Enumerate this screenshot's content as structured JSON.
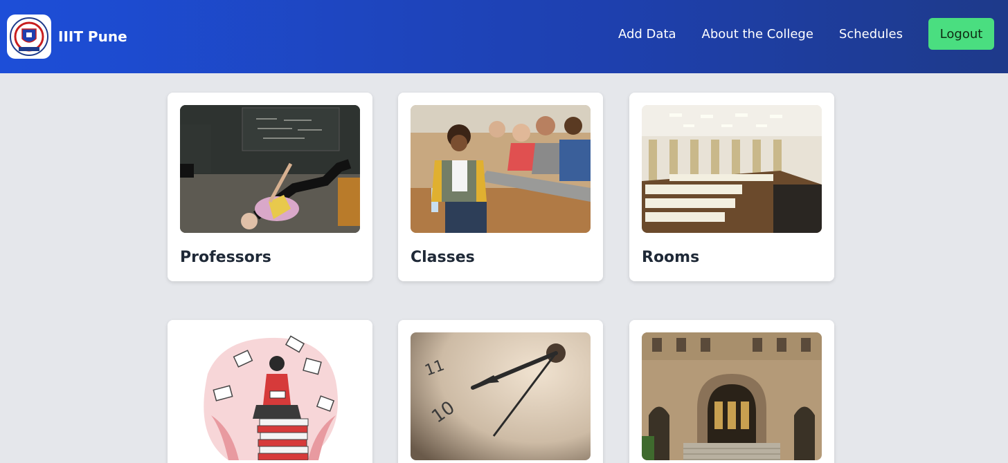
{
  "navbar": {
    "brand": "IIIT Pune",
    "links": [
      "Add Data",
      "About the College",
      "Schedules"
    ],
    "logout_label": "Logout"
  },
  "cards": [
    {
      "title": "Professors",
      "image": "professor-at-chalkboard-image"
    },
    {
      "title": "Classes",
      "image": "students-in-lecture-hall-image"
    },
    {
      "title": "Rooms",
      "image": "auditorium-room-image"
    },
    {
      "title": "",
      "image": "girl-reading-on-books-illustration"
    },
    {
      "title": "",
      "image": "clock-face-closeup-image"
    },
    {
      "title": "",
      "image": "college-building-entrance-image"
    }
  ],
  "colors": {
    "navbar_start": "#1d4ed8",
    "navbar_end": "#1e3a8a",
    "logout": "#4ade80",
    "page_bg": "#e5e7eb"
  }
}
